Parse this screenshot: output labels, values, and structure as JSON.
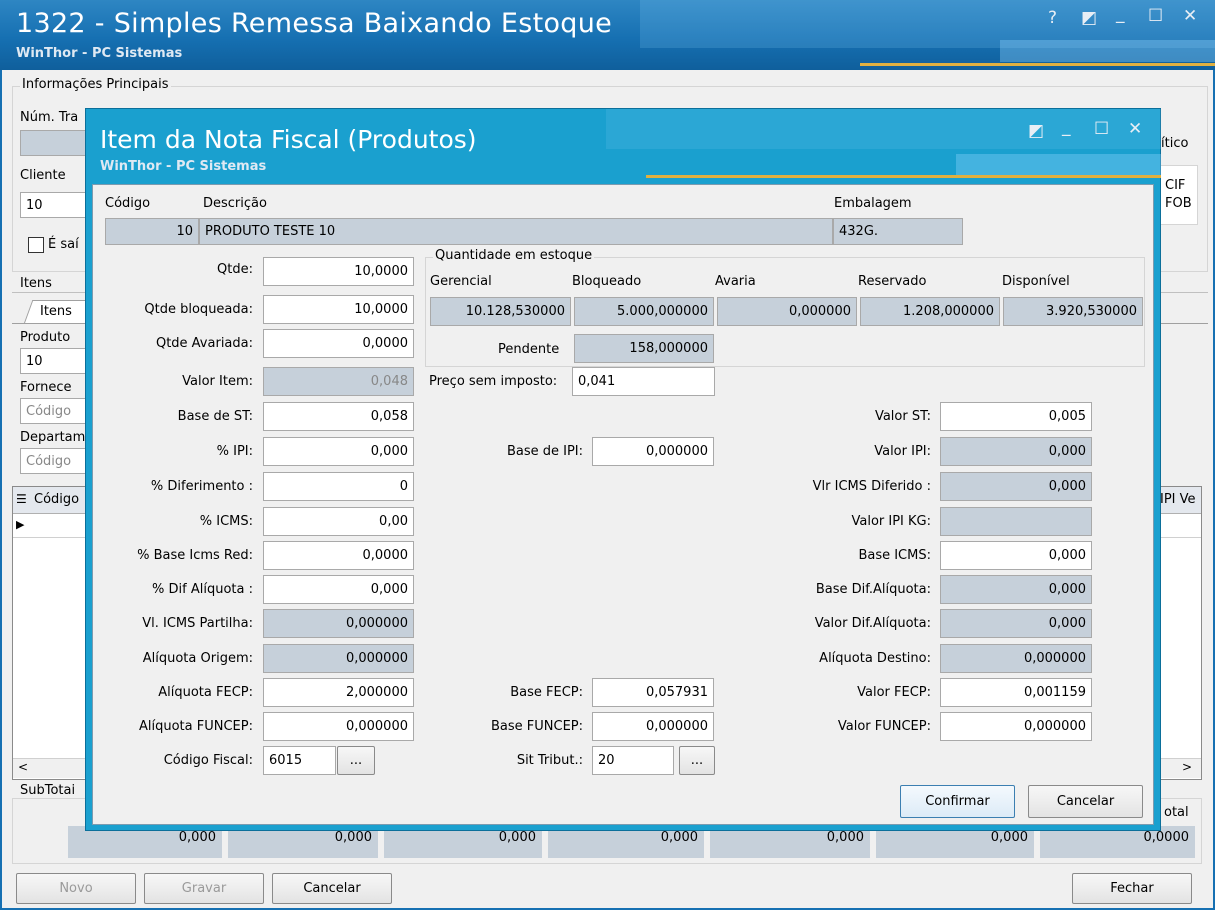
{
  "window": {
    "title": "1322 - Simples Remessa Baixando Estoque",
    "subtitle": "WinThor - PC Sistemas",
    "buttons": {
      "help": "?",
      "restore": "◩",
      "minimize": "_",
      "maximize": "☐",
      "close": "✕"
    }
  },
  "main": {
    "group_label": "Informações Principais",
    "num_tra_label": "Núm. Tra",
    "cliente_label": "Cliente",
    "cliente_value": "10",
    "e_saida_label": "É saí",
    "right_partial_label": "ítico",
    "cif_label": "CIF",
    "fob_label": "FOB",
    "itens_label": "Itens",
    "itens_tab": "Itens",
    "produto_label": "Produto",
    "produto_value": "10",
    "fornecedor_label": "Fornece",
    "fornecedor_placeholder": "Código",
    "departamento_label": "Departam",
    "departamento_placeholder": "Código",
    "grid_col_codigo": "Código",
    "grid_col_ipi": "IPI Ve",
    "subtotais_label": "SubTotai",
    "total_label": "otal",
    "subtotals": [
      "0,000",
      "0,000",
      "0,000",
      "0,000",
      "0,000",
      "0,000",
      "0,000",
      "0,0000"
    ],
    "buttons": {
      "novo": "Novo",
      "gravar": "Gravar",
      "cancelar": "Cancelar",
      "fechar": "Fechar"
    }
  },
  "dialog": {
    "title": "Item da Nota Fiscal (Produtos)",
    "subtitle": "WinThor - PC Sistemas",
    "buttons": {
      "restore": "◩",
      "minimize": "_",
      "maximize": "☐",
      "close": "✕"
    },
    "header": {
      "codigo_label": "Código",
      "codigo_value": "10",
      "descricao_label": "Descrição",
      "descricao_value": "PRODUTO TESTE 10",
      "embalagem_label": "Embalagem",
      "embalagem_value": "432G."
    },
    "stock": {
      "group_label": "Quantidade em estoque",
      "gerencial_label": "Gerencial",
      "gerencial_value": "10.128,530000",
      "bloqueado_label": "Bloqueado",
      "bloqueado_value": "5.000,000000",
      "avaria_label": "Avaria",
      "avaria_value": "0,000000",
      "reservado_label": "Reservado",
      "reservado_value": "1.208,000000",
      "disponivel_label": "Disponível",
      "disponivel_value": "3.920,530000",
      "pendente_label": "Pendente",
      "pendente_value": "158,000000"
    },
    "left": {
      "qtde_label": "Qtde:",
      "qtde_value": "10,0000",
      "qtde_bloq_label": "Qtde bloqueada:",
      "qtde_bloq_value": "10,0000",
      "qtde_avar_label": "Qtde Avariada:",
      "qtde_avar_value": "0,0000",
      "valor_item_label": "Valor Item:",
      "valor_item_value": "0,048",
      "base_st_label": "Base de ST:",
      "base_st_value": "0,058",
      "pct_ipi_label": "% IPI:",
      "pct_ipi_value": "0,000",
      "pct_dif_label": "%  Diferimento :",
      "pct_dif_value": "0",
      "pct_icms_label": "% ICMS:",
      "pct_icms_value": "0,00",
      "pct_base_red_label": "% Base Icms Red:",
      "pct_base_red_value": "0,0000",
      "pct_dif_aliq_label": "% Dif Alíquota :",
      "pct_dif_aliq_value": "0,000",
      "vl_icms_part_label": "Vl. ICMS Partilha:",
      "vl_icms_part_value": "0,000000",
      "aliq_origem_label": "Alíquota Origem:",
      "aliq_origem_value": "0,000000",
      "aliq_fecp_label": "Alíquota FECP:",
      "aliq_fecp_value": "2,000000",
      "aliq_funcep_label": "Alíquota FUNCEP:",
      "aliq_funcep_value": "0,000000",
      "cod_fiscal_label": "Código Fiscal:",
      "cod_fiscal_value": "6015"
    },
    "middle": {
      "preco_label": "Preço sem imposto:",
      "preco_value": "0,041",
      "base_ipi_label": "Base de IPI:",
      "base_ipi_value": "0,000000",
      "base_fecp_label": "Base FECP:",
      "base_fecp_value": "0,057931",
      "base_funcep_label": "Base FUNCEP:",
      "base_funcep_value": "0,000000",
      "sit_trib_label": "Sit Tribut.:",
      "sit_trib_value": "20"
    },
    "right": {
      "valor_st_label": "Valor ST:",
      "valor_st_value": "0,005",
      "valor_ipi_label": "Valor IPI:",
      "valor_ipi_value": "0,000",
      "vlr_icms_dif_label": "Vlr ICMS Diferido :",
      "vlr_icms_dif_value": "0,000",
      "valor_ipi_kg_label": "Valor IPI KG:",
      "valor_ipi_kg_value": "",
      "base_icms_label": "Base ICMS:",
      "base_icms_value": "0,000",
      "base_dif_aliq_label": "Base Dif.Alíquota:",
      "base_dif_aliq_value": "0,000",
      "valor_dif_aliq_label": "Valor Dif.Alíquota:",
      "valor_dif_aliq_value": "0,000",
      "aliq_destino_label": "Alíquota Destino:",
      "aliq_destino_value": "0,000000",
      "valor_fecp_label": "Valor FECP:",
      "valor_fecp_value": "0,001159",
      "valor_funcep_label": "Valor FUNCEP:",
      "valor_funcep_value": "0,000000"
    },
    "ellipsis": "...",
    "confirmar": "Confirmar",
    "cancelar": "Cancelar"
  }
}
